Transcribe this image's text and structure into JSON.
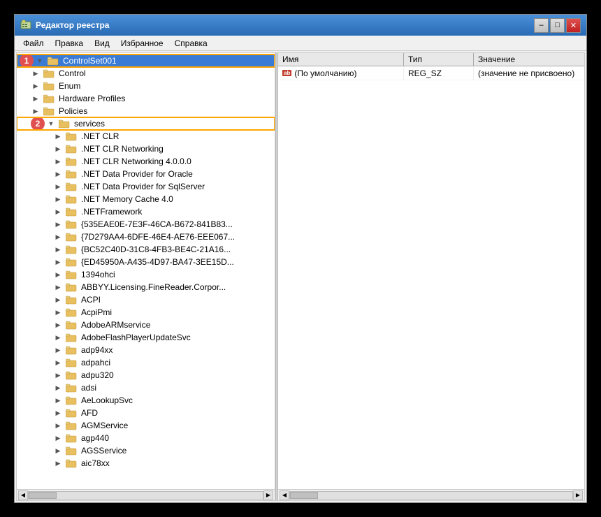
{
  "window": {
    "title": "Редактор реестра",
    "min_label": "–",
    "max_label": "□",
    "close_label": "✕"
  },
  "menu": {
    "items": [
      "Файл",
      "Правка",
      "Вид",
      "Избранное",
      "Справка"
    ]
  },
  "tree": {
    "items": [
      {
        "indent": 1,
        "label": "ControlSet001",
        "expanded": true,
        "badge": "1",
        "selected": true
      },
      {
        "indent": 2,
        "label": "Control",
        "expanded": false
      },
      {
        "indent": 2,
        "label": "Enum",
        "expanded": false
      },
      {
        "indent": 2,
        "label": "Hardware Profiles",
        "expanded": false
      },
      {
        "indent": 2,
        "label": "Policies",
        "expanded": false
      },
      {
        "indent": 2,
        "label": "services",
        "expanded": true,
        "badge": "2",
        "services": true
      },
      {
        "indent": 3,
        "label": ".NET CLR"
      },
      {
        "indent": 3,
        "label": ".NET CLR Networking"
      },
      {
        "indent": 3,
        "label": ".NET CLR Networking 4.0.0.0"
      },
      {
        "indent": 3,
        "label": ".NET Data Provider for Oracle"
      },
      {
        "indent": 3,
        "label": ".NET Data Provider for SqlServer"
      },
      {
        "indent": 3,
        "label": ".NET Memory Cache 4.0"
      },
      {
        "indent": 3,
        "label": ".NETFramework"
      },
      {
        "indent": 3,
        "label": "{535EAE0E-7E3F-46CA-B672-841B83..."
      },
      {
        "indent": 3,
        "label": "{7D279AA4-6DFE-46E4-AE76-EEE067..."
      },
      {
        "indent": 3,
        "label": "{BC52C40D-31C8-4FB3-BE4C-21A16..."
      },
      {
        "indent": 3,
        "label": "{ED45950A-A435-4D97-BA47-3EE15D..."
      },
      {
        "indent": 3,
        "label": "1394ohci"
      },
      {
        "indent": 3,
        "label": "ABBYY.Licensing.FineReader.Corpor..."
      },
      {
        "indent": 3,
        "label": "ACPI"
      },
      {
        "indent": 3,
        "label": "AcpiPmi"
      },
      {
        "indent": 3,
        "label": "AdobeARMservice"
      },
      {
        "indent": 3,
        "label": "AdobeFlashPlayerUpdateSvc"
      },
      {
        "indent": 3,
        "label": "adp94xx"
      },
      {
        "indent": 3,
        "label": "adpahci"
      },
      {
        "indent": 3,
        "label": "adpu320"
      },
      {
        "indent": 3,
        "label": "adsi"
      },
      {
        "indent": 3,
        "label": "AeLookupSvc"
      },
      {
        "indent": 3,
        "label": "AFD"
      },
      {
        "indent": 3,
        "label": "AGMService"
      },
      {
        "indent": 3,
        "label": "agp440"
      },
      {
        "indent": 3,
        "label": "AGSService"
      },
      {
        "indent": 3,
        "label": "aic78xx"
      }
    ]
  },
  "registry_table": {
    "headers": [
      "Имя",
      "Тип",
      "Значение"
    ],
    "rows": [
      {
        "name": "(По умолчанию)",
        "type": "REG_SZ",
        "value": "(значение не присвоено)",
        "icon": "ab"
      }
    ]
  }
}
